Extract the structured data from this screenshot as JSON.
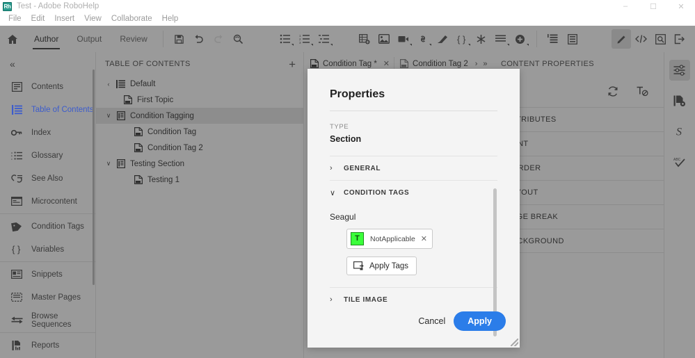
{
  "window": {
    "app_icon": "robohelp-icon",
    "title": "Test - Adobe RoboHelp",
    "minimize": "–",
    "maximize": "☐",
    "close": "✕"
  },
  "menubar": {
    "items": [
      {
        "label": "File"
      },
      {
        "label": "Edit"
      },
      {
        "label": "Insert"
      },
      {
        "label": "View"
      },
      {
        "label": "Collaborate"
      },
      {
        "label": "Help"
      }
    ]
  },
  "toolbar": {
    "home_icon": "home-icon",
    "tabs": [
      {
        "label": "Author",
        "active": true
      },
      {
        "label": "Output",
        "active": false
      },
      {
        "label": "Review",
        "active": false
      }
    ],
    "icons_left": [
      "save-icon",
      "undo-icon",
      "redo-icon",
      "find-replace-icon"
    ],
    "icons_lists": [
      "bullet-list-icon",
      "numbered-list-icon",
      "multilevel-list-icon"
    ],
    "icons_insert": [
      "insert-table-icon",
      "insert-image-icon",
      "insert-video-icon",
      "insert-link-icon",
      "insert-snippet-icon",
      "insert-variable-icon",
      "insert-special-character-icon",
      "paragraph-style-icon",
      "insert-more-icon"
    ],
    "icons_structure": [
      "show-markers-icon",
      "show-tags-icon"
    ],
    "icons_right": [
      "edit-pencil-icon",
      "code-view-icon",
      "preview-icon",
      "publish-icon"
    ]
  },
  "sidebar": {
    "collapse_icon": "collapse-chevrons-icon",
    "items": [
      {
        "label": "Contents",
        "icon": "contents-icon",
        "active": false
      },
      {
        "label": "Table of Contents",
        "icon": "table-of-contents-icon",
        "active": true
      },
      {
        "label": "Index",
        "icon": "index-key-icon",
        "active": false
      },
      {
        "label": "Glossary",
        "icon": "glossary-icon",
        "active": false
      },
      {
        "label": "See Also",
        "icon": "see-also-icon",
        "active": false
      },
      {
        "label": "Microcontent",
        "icon": "microcontent-icon",
        "active": false
      },
      {
        "label": "Condition Tags",
        "icon": "condition-tag-icon",
        "active": false
      },
      {
        "label": "Variables",
        "icon": "variables-icon",
        "active": false
      },
      {
        "label": "Snippets",
        "icon": "snippets-icon",
        "active": false
      },
      {
        "label": "Master Pages",
        "icon": "master-pages-icon",
        "active": false
      },
      {
        "label": "Browse Sequences",
        "icon": "browse-sequences-icon",
        "active": false
      },
      {
        "label": "Reports",
        "icon": "reports-icon",
        "active": false
      }
    ]
  },
  "toc": {
    "title": "TABLE OF CONTENTS",
    "add_button": "+",
    "rows": [
      {
        "label": "Default",
        "icon": "toc-root-icon",
        "arrow": "‹",
        "indent": 0,
        "selected": false
      },
      {
        "label": "First Topic",
        "icon": "topic-icon",
        "arrow": "",
        "indent": 1,
        "selected": false
      },
      {
        "label": "Condition Tagging",
        "icon": "section-icon",
        "arrow": "∨",
        "indent": 0,
        "selected": true
      },
      {
        "label": "Condition Tag",
        "icon": "topic-icon",
        "arrow": "",
        "indent": 2,
        "selected": false
      },
      {
        "label": "Condition Tag 2",
        "icon": "topic-icon",
        "arrow": "",
        "indent": 2,
        "selected": false
      },
      {
        "label": "Testing Section",
        "icon": "section-icon",
        "arrow": "∨",
        "indent": 0,
        "selected": false
      },
      {
        "label": "Testing 1",
        "icon": "topic-icon",
        "arrow": "",
        "indent": 2,
        "selected": false
      }
    ]
  },
  "editor_tabs": {
    "tabs": [
      {
        "label": "Condition Tag *",
        "icon": "topic-icon",
        "close": "✕"
      },
      {
        "label": "Condition Tag 2",
        "icon": "topic-icon",
        "close": ""
      }
    ],
    "next_chevron": "›",
    "overflow_chevron": "»"
  },
  "content_properties": {
    "title": "CONTENT PROPERTIES",
    "tools": [
      "refresh-icon",
      "clear-formatting-icon"
    ],
    "sections": [
      {
        "label": "ATTRIBUTES"
      },
      {
        "label": "FONT"
      },
      {
        "label": "BORDER"
      },
      {
        "label": "LAYOUT"
      },
      {
        "label": "PAGE BREAK"
      },
      {
        "label": "BACKGROUND"
      }
    ]
  },
  "right_rail": {
    "buttons": [
      {
        "icon": "content-properties-icon",
        "active": true
      },
      {
        "icon": "topic-properties-icon",
        "active": false
      },
      {
        "icon": "character-styles-icon",
        "label": "S",
        "active": false
      },
      {
        "icon": "spell-check-icon",
        "active": false
      }
    ]
  },
  "dialog": {
    "title": "Properties",
    "type_label": "TYPE",
    "type_value": "Section",
    "sections": [
      {
        "label": "GENERAL",
        "expanded": false,
        "twisty": "›"
      },
      {
        "label": "CONDITION TAGS",
        "expanded": true,
        "twisty": "∨"
      },
      {
        "label": "TILE IMAGE",
        "expanded": false,
        "twisty": "›"
      }
    ],
    "condition_tags": {
      "set_name": "Seagul",
      "tag": {
        "swatch_letter": "T",
        "swatch_color": "#3bff3b",
        "name": "NotApplicable",
        "remove": "✕"
      },
      "apply_tags_label": "Apply Tags",
      "apply_tags_icon": "apply-tags-icon"
    },
    "cancel_label": "Cancel",
    "apply_label": "Apply",
    "accent_color": "#2b7de9"
  }
}
